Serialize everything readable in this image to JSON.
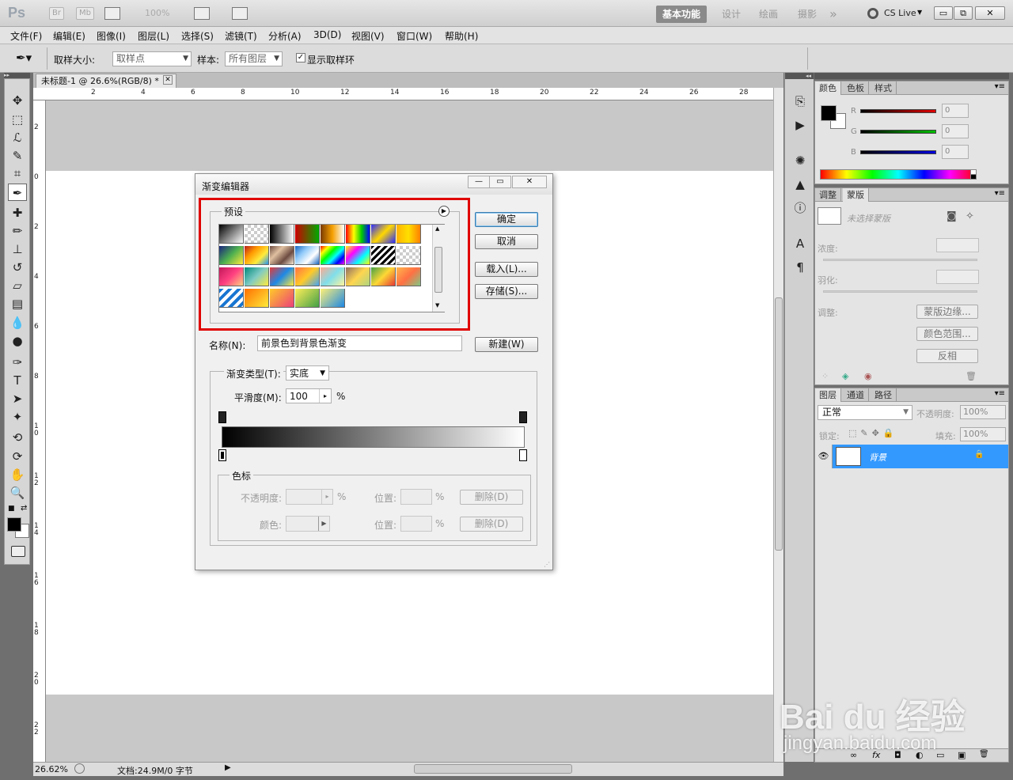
{
  "app": {
    "logo": "Ps",
    "chips": [
      "Br",
      "Mb"
    ],
    "zoom": "100%",
    "workspaces": [
      "基本功能",
      "设计",
      "绘画",
      "摄影"
    ],
    "workspace_more": "»",
    "cs_live": "CS Live",
    "window_controls": [
      "▭",
      "⧉",
      "✕"
    ]
  },
  "menu": [
    "文件(F)",
    "编辑(E)",
    "图像(I)",
    "图层(L)",
    "选择(S)",
    "滤镜(T)",
    "分析(A)",
    "3D(D)",
    "视图(V)",
    "窗口(W)",
    "帮助(H)"
  ],
  "options": {
    "sample_size_label": "取样大小:",
    "sample_size_value": "取样点",
    "sample_label": "样本:",
    "sample_value": "所有图层",
    "show_ring_label": "显示取样环"
  },
  "document": {
    "tab_title": "未标题-1 @ 26.6%(RGB/8) *",
    "ruler_h": [
      "2",
      "4",
      "6",
      "8",
      "10",
      "12",
      "14",
      "16",
      "18",
      "20",
      "22",
      "24",
      "26",
      "28"
    ],
    "ruler_v": [
      "2",
      "0",
      "2",
      "4",
      "6",
      "8",
      "10",
      "12",
      "14",
      "16",
      "18",
      "20",
      "22"
    ],
    "status_zoom": "26.62%",
    "status_doc": "文档:24.9M/0 字节"
  },
  "dialog": {
    "title": "渐变编辑器",
    "presets_label": "预设",
    "ok": "确定",
    "cancel": "取消",
    "load": "载入(L)...",
    "save": "存储(S)...",
    "name_label": "名称(N):",
    "name_value": "前景色到背景色渐变",
    "new_button": "新建(W)",
    "gradient_type_label": "渐变类型(T):",
    "gradient_type_value": "实底",
    "smoothness_label": "平滑度(M):",
    "smoothness_value": "100",
    "percent": "%",
    "stops_label": "色标",
    "opacity_label": "不透明度:",
    "color_label": "颜色:",
    "location_label": "位置:",
    "delete_label": "删除(D)",
    "swatches": [
      "linear-gradient(135deg,#000,#fff)",
      "repeating-conic-gradient(#ccc 0 25%,#fff 0 50%) 0 0/8px 8px",
      "linear-gradient(90deg,#000,#fff)",
      "linear-gradient(90deg,#c00,#0a0)",
      "linear-gradient(90deg,#7a3a00,#f5a000,#fff)",
      "linear-gradient(90deg,#f00,#ff0,#0c0,#00f)",
      "linear-gradient(135deg,#2b2bff,#ffd800,#2b2bff)",
      "linear-gradient(90deg,#ffb000,#ffe000,#ff8000)",
      "linear-gradient(135deg,#1a237e,#4caf50,#ffeb3b)",
      "linear-gradient(135deg,#b71c1c,#ff9800,#ffeb3b,#2196f3)",
      "linear-gradient(135deg,#6d4c41,#e0c0a0,#6d4c41,#f5e6d3)",
      "linear-gradient(135deg,#1565c0,#90caf9,#fff,#1565c0)",
      "linear-gradient(135deg,#f00,#ff0,#0f0,#0ff,#00f,#f0f)",
      "linear-gradient(135deg,#ff0,#f0f,#0ff,#ff0)",
      "repeating-linear-gradient(135deg,#000 0 3px,#fff 3px 6px)",
      "repeating-conic-gradient(#ccc 0 25%,#fff 0 50%) 0 0/8px 8px",
      "linear-gradient(135deg,#c2185b,#ff4081,#ffd180)",
      "linear-gradient(135deg,#00897b,#80cbc4,#ffeb3b)",
      "linear-gradient(135deg,#e53935,#1e88e5,#ffeb3b)",
      "linear-gradient(135deg,#ff7043,#ffca28,#42a5f5)",
      "linear-gradient(135deg,#ffab91,#80deea,#fff59d)",
      "linear-gradient(135deg,#8d6e63,#ffd54f,#aed581)",
      "linear-gradient(135deg,#43a047,#fdd835,#e53935)",
      "linear-gradient(135deg,#ffb74d,#ff7043,#81c784)",
      "repeating-linear-gradient(135deg,#1976d2 0 4px,#fff 4px 8px)",
      "linear-gradient(135deg,#ff6f00,#ffeb3b)",
      "linear-gradient(135deg,#ffca28,#ec407a)",
      "linear-gradient(135deg,#ffee58,#43a047)",
      "linear-gradient(135deg,#fff176,#1e88e5)"
    ]
  },
  "color_panel": {
    "tabs": [
      "颜色",
      "色板",
      "样式"
    ],
    "channels": [
      {
        "name": "R",
        "value": "0",
        "color": "#e00000"
      },
      {
        "name": "G",
        "value": "0",
        "color": "#00c000"
      },
      {
        "name": "B",
        "value": "0",
        "color": "#0000e0"
      }
    ]
  },
  "masks_panel": {
    "tabs": [
      "调整",
      "蒙版"
    ],
    "no_selection": "未选择蒙版",
    "density_label": "浓度:",
    "feather_label": "羽化:",
    "refine_label": "调整:",
    "mask_edge": "蒙版边缘...",
    "color_range": "颜色范围...",
    "invert": "反相"
  },
  "layers_panel": {
    "tabs": [
      "图层",
      "通道",
      "路径"
    ],
    "blend_mode": "正常",
    "opacity_label": "不透明度:",
    "opacity_value": "100%",
    "lock_label": "锁定:",
    "fill_label": "填充:",
    "fill_value": "100%",
    "layer_name": "背景",
    "footer_icons": [
      "∞",
      "fx",
      "◘",
      "◐",
      "▭",
      "▣",
      "🗑"
    ]
  },
  "watermark": {
    "brand": "Bai du 经验",
    "url": "jingyan.baidu.com"
  },
  "colors": {
    "accent_blue": "#3399ff",
    "highlight_red": "#e00000"
  }
}
